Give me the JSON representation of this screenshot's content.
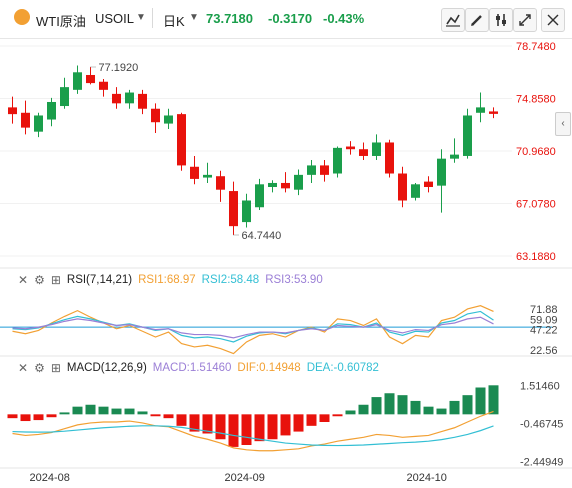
{
  "header": {
    "symbol": "WTI原油",
    "code": "USOIL",
    "timeframe": "日K",
    "price": "73.7180",
    "change": "-0.3170",
    "change_pct": "-0.43%",
    "change_color": "#1a9e4b"
  },
  "panes": {
    "rsi": {
      "label": "RSI(7,14,21)",
      "v1": "RSI1:68.97",
      "v2": "RSI2:58.48",
      "v3": "RSI3:53.90",
      "c1": "#f2a033",
      "c2": "#33bfd4",
      "c3": "#9b7fd6"
    },
    "macd": {
      "label": "MACD(12,26,9)",
      "v1": "MACD:1.51460",
      "v2": "DIF:0.14948",
      "v3": "DEA:-0.60782",
      "c1": "#9b7fd6",
      "c2": "#f2a033",
      "c3": "#33bfd4"
    }
  },
  "chart_data": [
    {
      "type": "candlestick",
      "title": "WTI原油 USOIL 日K",
      "up_color": "#1a9e4b",
      "down_color": "#e8120c",
      "y_ticks": [
        78.748,
        74.858,
        70.968,
        67.078,
        63.188
      ],
      "y_tick_labels": [
        "78.7480",
        "74.8580",
        "70.9680",
        "67.0780",
        "63.1880"
      ],
      "ylim": [
        63.188,
        78.748
      ],
      "x_ticks": [
        "2024-08",
        "2024-09",
        "2024-10"
      ],
      "annotations": [
        {
          "label": "77.1920",
          "value": 77.192,
          "bar": 6
        },
        {
          "label": "64.7440",
          "value": 64.744,
          "bar": 17
        }
      ],
      "candles": [
        {
          "o": 74.2,
          "h": 75.0,
          "l": 73.0,
          "c": 73.7
        },
        {
          "o": 73.8,
          "h": 74.7,
          "l": 72.2,
          "c": 72.7
        },
        {
          "o": 72.4,
          "h": 73.8,
          "l": 72.0,
          "c": 73.6
        },
        {
          "o": 73.3,
          "h": 74.9,
          "l": 72.8,
          "c": 74.6
        },
        {
          "o": 74.3,
          "h": 76.4,
          "l": 74.1,
          "c": 75.7
        },
        {
          "o": 75.5,
          "h": 77.3,
          "l": 75.2,
          "c": 76.8
        },
        {
          "o": 76.6,
          "h": 77.192,
          "l": 75.9,
          "c": 76.0
        },
        {
          "o": 76.1,
          "h": 76.3,
          "l": 75.0,
          "c": 75.5
        },
        {
          "o": 75.2,
          "h": 75.7,
          "l": 74.1,
          "c": 74.5
        },
        {
          "o": 74.5,
          "h": 75.5,
          "l": 74.1,
          "c": 75.3
        },
        {
          "o": 75.2,
          "h": 75.5,
          "l": 73.7,
          "c": 74.1
        },
        {
          "o": 74.1,
          "h": 74.5,
          "l": 72.3,
          "c": 73.1
        },
        {
          "o": 73.0,
          "h": 74.1,
          "l": 72.6,
          "c": 73.6
        },
        {
          "o": 73.7,
          "h": 73.8,
          "l": 69.5,
          "c": 69.9
        },
        {
          "o": 69.8,
          "h": 70.6,
          "l": 68.5,
          "c": 68.9
        },
        {
          "o": 69.0,
          "h": 70.1,
          "l": 68.6,
          "c": 69.2
        },
        {
          "o": 69.1,
          "h": 69.5,
          "l": 67.2,
          "c": 68.1
        },
        {
          "o": 68.0,
          "h": 68.7,
          "l": 64.744,
          "c": 65.4
        },
        {
          "o": 65.7,
          "h": 67.8,
          "l": 65.3,
          "c": 67.3
        },
        {
          "o": 66.8,
          "h": 68.9,
          "l": 66.6,
          "c": 68.5
        },
        {
          "o": 68.3,
          "h": 68.8,
          "l": 67.9,
          "c": 68.6
        },
        {
          "o": 68.6,
          "h": 69.4,
          "l": 67.9,
          "c": 68.2
        },
        {
          "o": 68.1,
          "h": 69.6,
          "l": 67.7,
          "c": 69.2
        },
        {
          "o": 69.2,
          "h": 70.3,
          "l": 68.6,
          "c": 69.9
        },
        {
          "o": 69.9,
          "h": 70.3,
          "l": 68.7,
          "c": 69.2
        },
        {
          "o": 69.3,
          "h": 71.3,
          "l": 69.0,
          "c": 71.2
        },
        {
          "o": 71.3,
          "h": 71.7,
          "l": 70.7,
          "c": 71.1
        },
        {
          "o": 71.1,
          "h": 71.6,
          "l": 70.3,
          "c": 70.6
        },
        {
          "o": 70.6,
          "h": 72.2,
          "l": 70.3,
          "c": 71.6
        },
        {
          "o": 71.6,
          "h": 71.8,
          "l": 69.0,
          "c": 69.3
        },
        {
          "o": 69.3,
          "h": 69.8,
          "l": 66.8,
          "c": 67.3
        },
        {
          "o": 67.5,
          "h": 68.6,
          "l": 67.3,
          "c": 68.5
        },
        {
          "o": 68.7,
          "h": 69.1,
          "l": 67.9,
          "c": 68.3
        },
        {
          "o": 68.4,
          "h": 71.1,
          "l": 66.4,
          "c": 70.4
        },
        {
          "o": 70.4,
          "h": 71.9,
          "l": 70.1,
          "c": 70.7
        },
        {
          "o": 70.6,
          "h": 74.1,
          "l": 70.4,
          "c": 73.6
        },
        {
          "o": 73.8,
          "h": 75.3,
          "l": 73.1,
          "c": 74.2
        },
        {
          "o": 73.9,
          "h": 74.2,
          "l": 73.4,
          "c": 73.718
        }
      ]
    },
    {
      "type": "line",
      "title": "RSI(7,14,21)",
      "y_ticks": [
        71.88,
        59.09,
        47.22,
        22.56
      ],
      "y_tick_labels": [
        "71.88",
        "59.09",
        "47.22",
        "22.56"
      ],
      "ylim": [
        15,
        95
      ],
      "reference_line": 50.0,
      "series": [
        {
          "name": "RSI1",
          "color": "#f2a033",
          "values": [
            45,
            42,
            46,
            55,
            63,
            70,
            62,
            55,
            48,
            52,
            45,
            38,
            44,
            30,
            26,
            28,
            24,
            18,
            32,
            40,
            42,
            38,
            46,
            50,
            44,
            60,
            58,
            52,
            60,
            38,
            30,
            40,
            38,
            58,
            62,
            72,
            76,
            69
          ]
        },
        {
          "name": "RSI2",
          "color": "#33bfd4",
          "values": [
            48,
            47,
            49,
            54,
            59,
            63,
            60,
            56,
            52,
            54,
            50,
            46,
            48,
            40,
            37,
            38,
            36,
            32,
            39,
            43,
            44,
            42,
            46,
            49,
            46,
            54,
            53,
            50,
            55,
            44,
            40,
            45,
            44,
            55,
            58,
            66,
            69,
            58.5
          ]
        },
        {
          "name": "RSI3",
          "color": "#9b7fd6",
          "values": [
            49,
            48,
            50,
            53,
            57,
            60,
            58,
            55,
            52,
            53,
            50,
            47,
            48,
            43,
            41,
            41,
            40,
            37,
            41,
            44,
            44,
            43,
            46,
            48,
            46,
            52,
            51,
            50,
            53,
            46,
            43,
            47,
            46,
            53,
            55,
            60,
            62,
            53.9
          ]
        }
      ]
    },
    {
      "type": "bar+line",
      "title": "MACD(12,26,9)",
      "y_ticks": [
        1.5146,
        -0.46745,
        -2.44949
      ],
      "y_tick_labels": [
        "1.51460",
        "-0.46745",
        "-2.44949"
      ],
      "ylim": [
        -2.8,
        2.0
      ],
      "histogram": {
        "name": "MACD",
        "values": [
          -0.2,
          -0.35,
          -0.3,
          -0.15,
          0.1,
          0.4,
          0.5,
          0.4,
          0.3,
          0.3,
          0.15,
          -0.1,
          -0.2,
          -0.6,
          -0.9,
          -1.0,
          -1.3,
          -1.7,
          -1.6,
          -1.4,
          -1.3,
          -1.1,
          -0.9,
          -0.6,
          -0.4,
          -0.1,
          0.2,
          0.5,
          0.9,
          1.1,
          1.0,
          0.7,
          0.4,
          0.3,
          0.7,
          1.0,
          1.4,
          1.5146
        ]
      },
      "series": [
        {
          "name": "DIF",
          "color": "#f2a033",
          "values": [
            -1.0,
            -1.1,
            -1.05,
            -0.95,
            -0.75,
            -0.55,
            -0.45,
            -0.4,
            -0.4,
            -0.35,
            -0.45,
            -0.6,
            -0.65,
            -0.9,
            -1.15,
            -1.3,
            -1.5,
            -1.75,
            -1.85,
            -1.9,
            -1.9,
            -1.85,
            -1.8,
            -1.65,
            -1.55,
            -1.4,
            -1.3,
            -1.2,
            -1.05,
            -1.1,
            -1.2,
            -1.15,
            -1.1,
            -0.9,
            -0.7,
            -0.4,
            -0.1,
            0.14948
          ]
        },
        {
          "name": "DEA",
          "color": "#33bfd4",
          "values": [
            -0.9,
            -0.92,
            -0.93,
            -0.92,
            -0.88,
            -0.82,
            -0.76,
            -0.7,
            -0.66,
            -0.62,
            -0.6,
            -0.6,
            -0.62,
            -0.68,
            -0.78,
            -0.88,
            -0.98,
            -1.1,
            -1.2,
            -1.3,
            -1.4,
            -1.5,
            -1.55,
            -1.6,
            -1.62,
            -1.63,
            -1.62,
            -1.6,
            -1.56,
            -1.52,
            -1.48,
            -1.45,
            -1.4,
            -1.32,
            -1.2,
            -1.05,
            -0.85,
            -0.60782
          ]
        }
      ]
    }
  ]
}
